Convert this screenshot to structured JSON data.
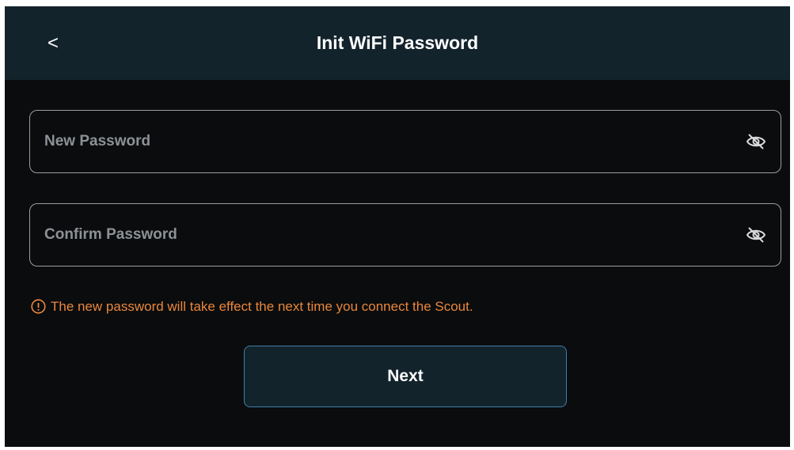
{
  "header": {
    "back_label": "<",
    "title": "Init WiFi Password"
  },
  "form": {
    "new_password": {
      "placeholder": "New Password",
      "value": "",
      "visibility_icon": "eye-slash-icon"
    },
    "confirm_password": {
      "placeholder": "Confirm Password",
      "value": "",
      "visibility_icon": "eye-slash-icon"
    }
  },
  "notice": {
    "icon": "exclamation-circle-icon",
    "text": "The new password will take effect the next time you connect the Scout."
  },
  "actions": {
    "next_label": "Next"
  },
  "colors": {
    "background": "#0b0c0d",
    "header": "#13232c",
    "warning": "#e9873e",
    "button_border": "#3d7fa8",
    "field_border": "#9a9ea2"
  }
}
